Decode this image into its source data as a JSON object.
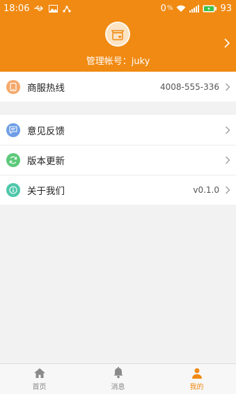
{
  "status_bar": {
    "time": "18:06",
    "net_rate": "0",
    "net_rate_unit": "%",
    "battery": "93",
    "icons": [
      "usb-icon",
      "image-icon",
      "share-icon",
      "wifi-icon",
      "signal-icon",
      "battery-icon"
    ]
  },
  "colors": {
    "accent": "#f08a12",
    "header_bg": "#f08a12",
    "page_bg": "#f2f2f2",
    "hotline_icon_bg": "#f5a86a",
    "feedback_icon_bg": "#6f9ee6",
    "update_icon_bg": "#5cc97a",
    "about_icon_bg": "#4fc7aa"
  },
  "profile": {
    "account_label": "管理帐号：juky",
    "avatar_icon": "shop-avatar-icon"
  },
  "menu": {
    "hotline": {
      "label": "商服热线",
      "value": "4008-555-336",
      "icon": "phone-icon"
    },
    "feedback": {
      "label": "意见反馈",
      "icon": "chat-icon"
    },
    "update": {
      "label": "版本更新",
      "icon": "refresh-icon"
    },
    "about": {
      "label": "关于我们",
      "value": "v0.1.0",
      "icon": "info-icon"
    }
  },
  "tabs": [
    {
      "label": "首页",
      "icon": "home-icon",
      "active": false
    },
    {
      "label": "消息",
      "icon": "bell-icon",
      "active": false
    },
    {
      "label": "我的",
      "icon": "person-icon",
      "active": true
    }
  ]
}
